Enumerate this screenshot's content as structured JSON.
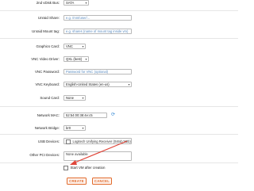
{
  "form": {
    "vdisk_bus_2": {
      "label": "2nd vDisk Bus:",
      "value": "SATA"
    },
    "unraid_share": {
      "label": "Unraid Share:",
      "placeholder": "e.g. /mnt/user/..."
    },
    "unraid_mount_tag": {
      "label": "Unraid Mount tag:",
      "placeholder": "e.g. shares (name of mount tag inside vm)"
    },
    "graphics_card": {
      "label": "Graphics Card:",
      "value": "VNC"
    },
    "vnc_video_driver": {
      "label": "VNC Video Driver:",
      "value": "QXL (best)"
    },
    "vnc_password": {
      "label": "VNC Password:",
      "placeholder": "Password for VNC (optional)"
    },
    "vnc_keyboard": {
      "label": "VNC Keyboard:",
      "value": "English-United States (en-us)"
    },
    "sound_card": {
      "label": "Sound Card:",
      "value": "None"
    },
    "network_mac": {
      "label": "Network MAC:",
      "value": "52:54:00:38:4e:c5"
    },
    "network_bridge": {
      "label": "Network Bridge:",
      "value": "br0"
    },
    "usb_devices": {
      "label": "USB Devices:",
      "option": "Logitech Unifying Receiver (046d:c52b)"
    },
    "other_pci": {
      "label": "Other PCI Devices:",
      "value": "None available"
    },
    "start_vm": {
      "label": "Start VM after creation"
    }
  },
  "buttons": {
    "create": "CREATE",
    "cancel": "CANCEL"
  },
  "icons": {
    "caret": "caret-down-icon",
    "refresh": "refresh-icon"
  },
  "colors": {
    "accent": "#e26b2c",
    "placeholder": "#5a8bbf",
    "arrow": "#e0463a",
    "refresh": "#3b8bd6"
  }
}
